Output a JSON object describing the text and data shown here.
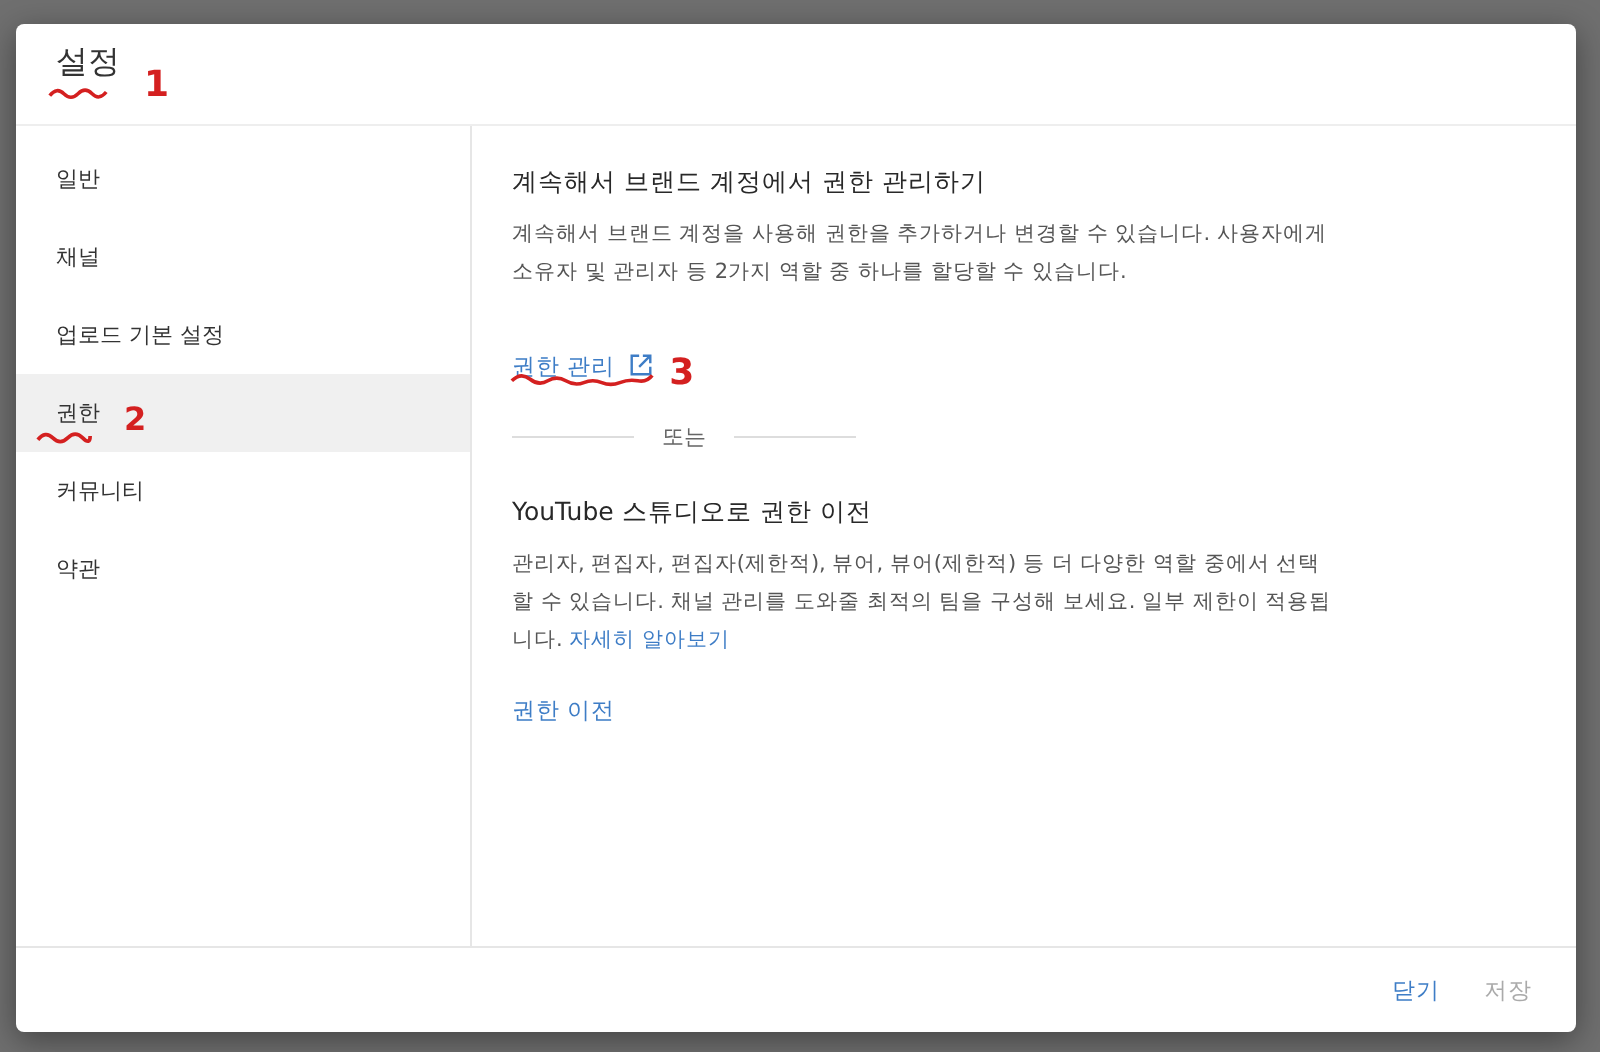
{
  "dialog": {
    "title": "설정",
    "annotation": "1"
  },
  "sidebar": {
    "items": [
      {
        "label": "일반",
        "selected": false
      },
      {
        "label": "채널",
        "selected": false
      },
      {
        "label": "업로드 기본 설정",
        "selected": false
      },
      {
        "label": "권한",
        "selected": true,
        "annotation": "2"
      },
      {
        "label": "커뮤니티",
        "selected": false
      },
      {
        "label": "약관",
        "selected": false
      }
    ]
  },
  "content": {
    "section_1": {
      "title": "계속해서 브랜드 계정에서 권한 관리하기",
      "body": "계속해서 브랜드 계정을 사용해 권한을 추가하거나 변경할 수 있습니다. 사용자에게 소유자 및 관리자 등 2가지 역할 중 하나를 할당할 수 있습니다.",
      "link": "권한 관리",
      "link_annotation": "3"
    },
    "divider_label": "또는",
    "section_2": {
      "title": "YouTube 스튜디오로 권한 이전",
      "body": "관리자, 편집자, 편집자(제한적), 뷰어, 뷰어(제한적) 등 더 다양한 역할 중에서 선택할 수 있습니다. 채널 관리를 도와줄 최적의 팀을 구성해 보세요. 일부 제한이 적용됩니다.",
      "body_link": "자세히 알아보기",
      "link": "권한 이전"
    }
  },
  "footer": {
    "buttons": [
      {
        "label": "닫기",
        "disabled": false
      },
      {
        "label": "저장",
        "disabled": true
      }
    ]
  }
}
